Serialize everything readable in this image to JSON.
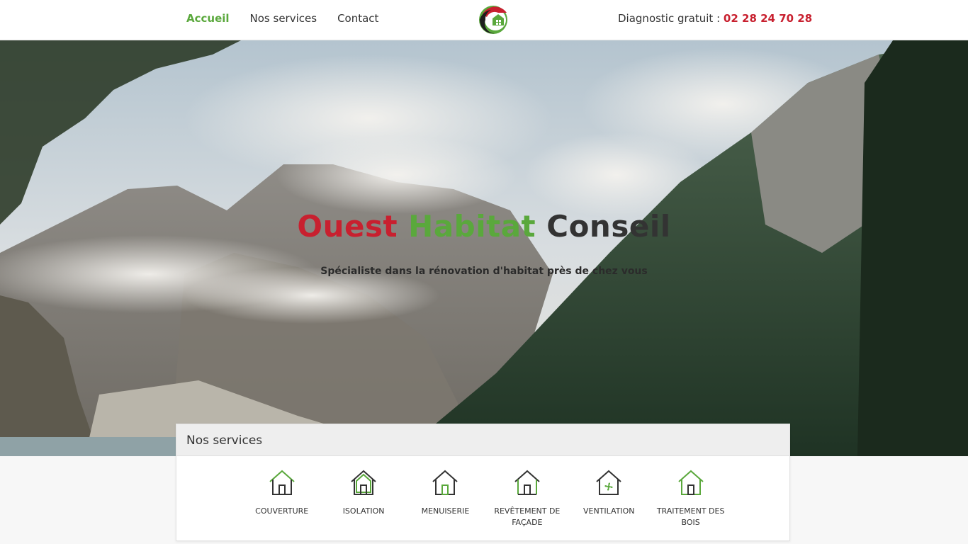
{
  "header": {
    "nav": [
      {
        "label": "Accueil",
        "active": true
      },
      {
        "label": "Nos services",
        "active": false
      },
      {
        "label": "Contact",
        "active": false
      }
    ],
    "phone_prefix": "Diagnostic gratuit : ",
    "phone_number": "02 28 24 70 28"
  },
  "hero": {
    "title_word1": "Ouest",
    "title_word2": "Habitat",
    "title_word3": "Conseil",
    "subtitle": "Spécialiste dans la rénovation d'habitat près de chez vous"
  },
  "services": {
    "heading": "Nos services",
    "items": [
      {
        "label": "COUVERTURE",
        "icon": "house-roof-icon"
      },
      {
        "label": "ISOLATION",
        "icon": "house-insulation-icon"
      },
      {
        "label": "MENUISERIE",
        "icon": "house-door-icon"
      },
      {
        "label": "REVÊTEMENT DE FAÇADE",
        "icon": "house-facade-icon"
      },
      {
        "label": "VENTILATION",
        "icon": "house-fan-icon"
      },
      {
        "label": "TRAITEMENT DES BOIS",
        "icon": "house-wood-icon"
      }
    ]
  },
  "colors": {
    "brand_red": "#c8202f",
    "brand_green": "#5aa83c",
    "text_dark": "#333333"
  }
}
